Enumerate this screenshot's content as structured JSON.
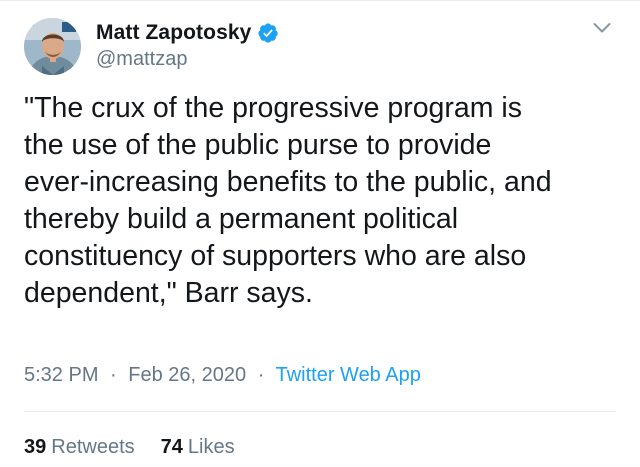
{
  "author": {
    "display_name": "Matt Zapotosky",
    "handle": "@mattzap",
    "verified_icon": "verified-badge-icon",
    "avatar_icon": "profile-photo"
  },
  "tweet": {
    "text_lines": [
      "\"The crux of the progressive program is",
      "the use of the public purse to provide",
      "ever-increasing benefits to the public, and",
      "thereby build a permanent political",
      "constituency of supporters who are also",
      "dependent,\" Barr says."
    ],
    "time": "5:32 PM",
    "separator": "·",
    "date": "Feb 26, 2020",
    "source": "Twitter Web App"
  },
  "stats": {
    "retweets_count": "39",
    "retweets_label": "Retweets",
    "likes_count": "74",
    "likes_label": "Likes"
  },
  "colors": {
    "text": "#14171a",
    "muted": "#657786",
    "accent": "#1da1f2",
    "divider": "#e6ecf0"
  }
}
